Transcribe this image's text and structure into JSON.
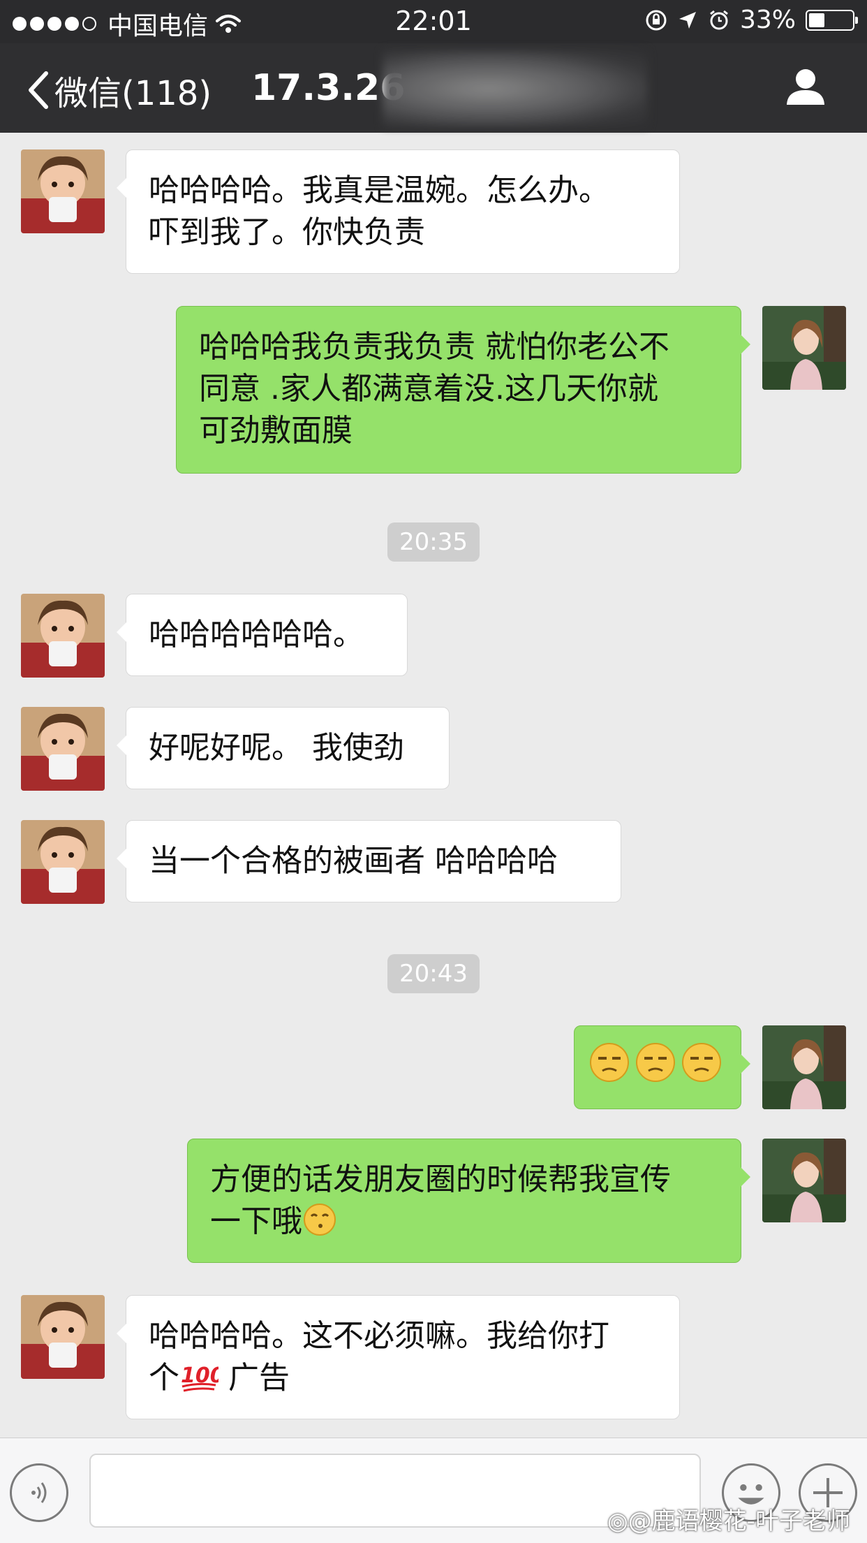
{
  "status_bar": {
    "carrier": "中国电信",
    "time": "22:01",
    "battery": "33%",
    "battery_level": 0.33
  },
  "nav": {
    "back_label": "微信(118)",
    "title": "17.3.26"
  },
  "timestamps": [
    "20:35",
    "20:43"
  ],
  "messages": [
    {
      "side": "in",
      "lines": [
        "哈哈哈哈。我真是温婉。怎么办。",
        "吓到我了。你快负责"
      ]
    },
    {
      "side": "out",
      "lines": [
        "哈哈哈我负责我负责 就怕你老公不",
        "同意 .家人都满意着没.这几天你就",
        "可劲敷面膜"
      ]
    },
    {
      "side": "in",
      "lines": [
        "哈哈哈哈哈哈。"
      ]
    },
    {
      "side": "in",
      "lines": [
        "好呢好呢。 我使劲"
      ]
    },
    {
      "side": "in",
      "lines": [
        "当一个合格的被画者 哈哈哈哈"
      ]
    },
    {
      "side": "out",
      "emoji": "skeptical-face-emoji x3"
    },
    {
      "side": "out",
      "lines": [
        "方便的话发朋友圈的时候帮我宣传",
        "一下哦"
      ],
      "trailing_emoji": "kissing-face-emoji"
    },
    {
      "side": "in",
      "lines": [
        "哈哈哈哈。这不必须嘛。我给你打",
        "个"
      ],
      "inline_emoji": "hundred-points-emoji",
      "line2_suffix": " 广告"
    }
  ],
  "watermark": "@鹿语樱花-叶子老师",
  "icons": {
    "back": "chevron-left-icon",
    "profile": "person-icon",
    "voice": "voice-icon",
    "emoji": "emoji-icon",
    "plus": "plus-icon"
  }
}
